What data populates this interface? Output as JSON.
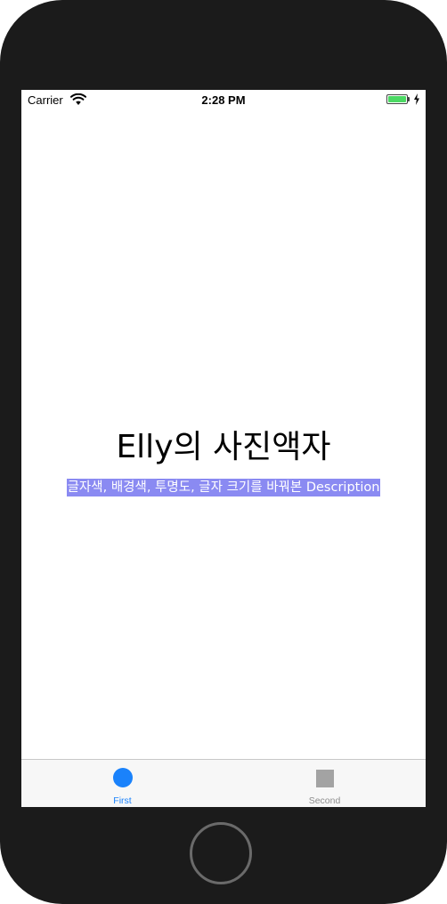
{
  "status_bar": {
    "carrier": "Carrier",
    "time": "2:28 PM",
    "battery_level": 1.0,
    "battery_color": "#4cd964",
    "wifi_icon": "wifi-icon",
    "charging_icon": "bolt-icon"
  },
  "main": {
    "title": "Elly의 사진액자",
    "description": "글자색, 배경색, 투명도, 글자 크기를 바꿔본 Description",
    "description_bg": "#8a8af2",
    "description_color": "#ffffff"
  },
  "tab_bar": {
    "tabs": [
      {
        "label": "First",
        "icon": "circle-icon",
        "selected": true,
        "color": "#1a82fb"
      },
      {
        "label": "Second",
        "icon": "square-icon",
        "selected": false,
        "color": "#8e8e8e"
      }
    ]
  },
  "device": {
    "home_button_icon": "home-button"
  }
}
